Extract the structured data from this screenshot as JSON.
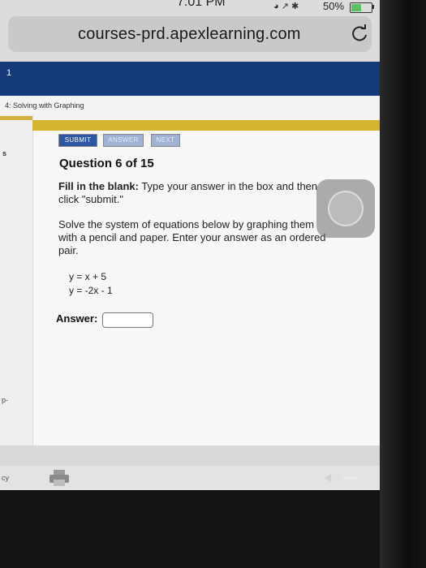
{
  "status_bar": {
    "time": "7:01 PM",
    "battery_percent": "50%",
    "battery_level": 0.5
  },
  "browser": {
    "url": "courses-prd.apexlearning.com",
    "reload_icon": "reload-icon"
  },
  "header": {
    "number": "1"
  },
  "breadcrumb": {
    "text": "4: Solving with Graphing"
  },
  "toolbar": {
    "submit_label": "SUBMIT",
    "answer_label": "ANSWER",
    "next_label": "NEXT"
  },
  "question": {
    "title": "Question 6 of 15",
    "instruction_bold": "Fill in the blank:",
    "instruction_rest": " Type your answer in the box and then click \"submit.\"",
    "problem": "Solve the system of equations below by graphing them with a pencil and paper. Enter your answer as an ordered pair.",
    "equations": [
      "y = x + 5",
      "y = -2x - 1"
    ],
    "answer_label": "Answer:",
    "answer_value": ""
  },
  "gutter": {
    "item_s": "s",
    "item_p": "p-",
    "item_cy": "cy"
  },
  "colors": {
    "header_navy": "#143a7a",
    "gold_bar": "#d6b42f",
    "submit_blue": "#2e56a7",
    "disabled_blue": "#9fb2d4"
  }
}
